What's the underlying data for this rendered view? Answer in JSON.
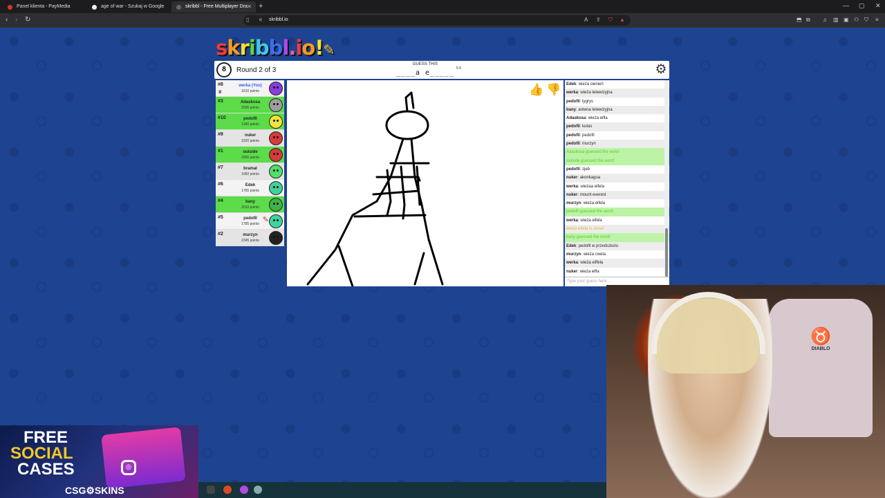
{
  "browser": {
    "tabs": [
      {
        "title": "Panel klienta - PayMedia",
        "active": false
      },
      {
        "title": "age of war - Szukaj w Google",
        "active": false
      },
      {
        "title": "skribbl - Free Multiplayer Dra",
        "active": true
      }
    ],
    "url": "skribbl.io"
  },
  "game": {
    "logo": "skribbl.io",
    "timer": "8",
    "round_text": "Round 2 of 3",
    "guess_label": "GUESS THIS",
    "word_hint": "____a e_____",
    "word_lengths": "5 6"
  },
  "players": [
    {
      "rank": "#8",
      "name": "werka (You)",
      "points": "1610 points",
      "guessed": false,
      "you": true,
      "avatar_color": "#8a3ddb"
    },
    {
      "rank": "#3",
      "name": "Adaskosa",
      "points": "2095 points",
      "guessed": true,
      "avatar_color": "#9e9e9e"
    },
    {
      "rank": "#10",
      "name": "pedofil",
      "points": "1360 points",
      "guessed": true,
      "avatar_color": "#f2e23a"
    },
    {
      "rank": "#9",
      "name": "nuker",
      "points": "1520 points",
      "guessed": false,
      "avatar_color": "#d83a3a"
    },
    {
      "rank": "#1",
      "name": "outside",
      "points": "2965 points",
      "guessed": true,
      "avatar_color": "#d83a3a"
    },
    {
      "rank": "#7",
      "name": "bramal",
      "points": "1660 points",
      "guessed": false,
      "avatar_color": "#4ee06a"
    },
    {
      "rank": "#6",
      "name": "Edek",
      "points": "1765 points",
      "guessed": false,
      "avatar_color": "#3fd39b"
    },
    {
      "rank": "#4",
      "name": "bany",
      "points": "2010 points",
      "guessed": true,
      "avatar_color": "#3fb34a"
    },
    {
      "rank": "#5",
      "name": "pedofil",
      "points": "1785 points",
      "guessed": false,
      "drawing": true,
      "avatar_color": "#3fd3a0"
    },
    {
      "rank": "#2",
      "name": "murzyn",
      "points": "2345 points",
      "guessed": false,
      "avatar_color": "#222222"
    }
  ],
  "chat": [
    {
      "user": "Edek",
      "text": "wieża cienień",
      "type": "normal"
    },
    {
      "user": "werka",
      "text": "wieża telewizyjna",
      "type": "normal"
    },
    {
      "user": "pedofil",
      "text": "tygrys",
      "type": "normal"
    },
    {
      "user": "bany",
      "text": "antena telewizyjna",
      "type": "normal"
    },
    {
      "user": "Adaskosa",
      "text": "wieża eifla",
      "type": "normal"
    },
    {
      "user": "pedofil",
      "text": "kutas",
      "type": "normal"
    },
    {
      "user": "pedofil",
      "text": "pedofil",
      "type": "normal"
    },
    {
      "user": "pedofil",
      "text": "murzyn",
      "type": "normal"
    },
    {
      "user": "",
      "text": "Adaskosa guessed the word!",
      "type": "green"
    },
    {
      "user": "",
      "text": "outside guessed the word!",
      "type": "green"
    },
    {
      "user": "pedofil",
      "text": "zjeb",
      "type": "normal"
    },
    {
      "user": "nuker",
      "text": "akonkagua",
      "type": "normal"
    },
    {
      "user": "werka",
      "text": "wieżaa eifela",
      "type": "normal"
    },
    {
      "user": "nuker",
      "text": "mount everest",
      "type": "normal"
    },
    {
      "user": "murzyn",
      "text": "wieża eifela",
      "type": "normal"
    },
    {
      "user": "",
      "text": "pedofil guessed the word!",
      "type": "green"
    },
    {
      "user": "werka",
      "text": "wieża eifela",
      "type": "normal"
    },
    {
      "user": "",
      "text": "wieża eifela is close!",
      "type": "yellow"
    },
    {
      "user": "",
      "text": "bany guessed the word!",
      "type": "green"
    },
    {
      "user": "Edek",
      "text": "pedofil w przedszkolu",
      "type": "normal"
    },
    {
      "user": "murzyn",
      "text": "wieża cwela",
      "type": "normal"
    },
    {
      "user": "werka",
      "text": "wieża eiffela",
      "type": "normal"
    },
    {
      "user": "nuker",
      "text": "wieża eifla",
      "type": "normal"
    }
  ],
  "chat_input_placeholder": "Type your guess here...",
  "promo": {
    "line1": "FREE",
    "line2": "SOCIAL",
    "line3": "CASES",
    "brand": "CSG⚙SKINS"
  },
  "chair_brand": "DIABLO"
}
